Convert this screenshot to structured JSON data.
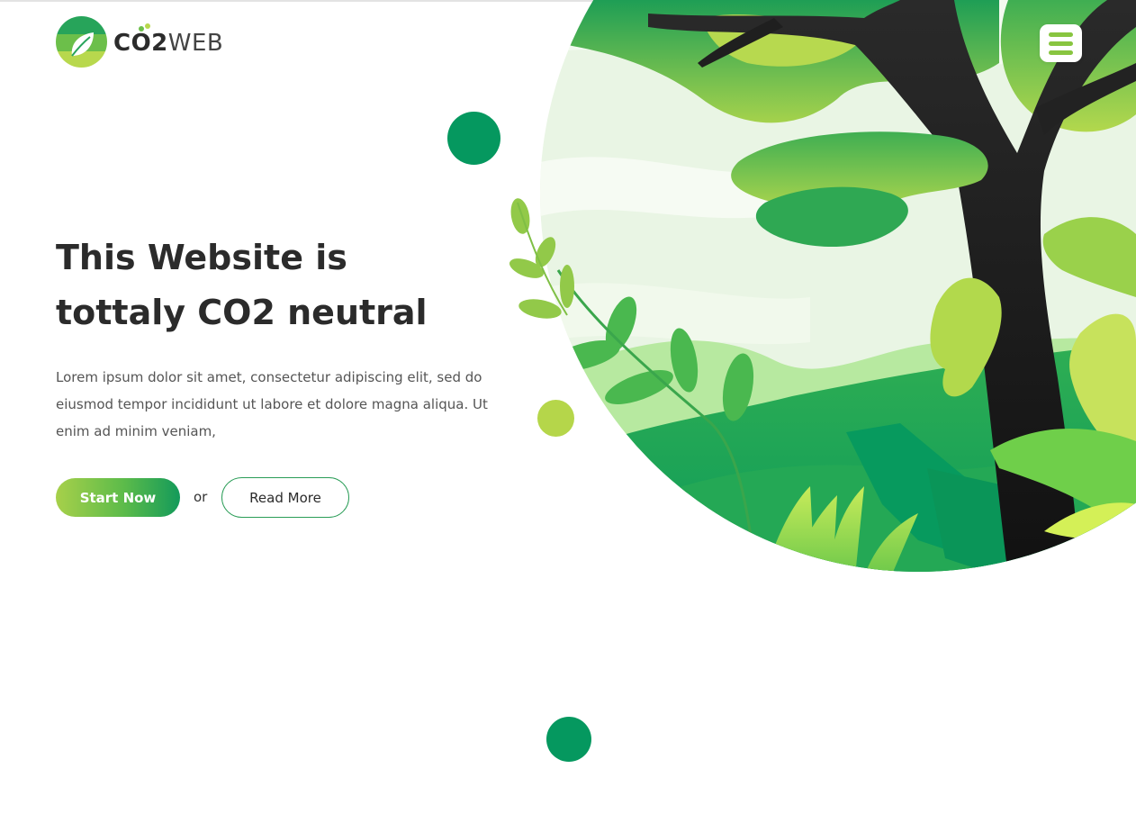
{
  "brand": {
    "logo_bold": "CO2",
    "logo_light": "WEB"
  },
  "hero": {
    "title": "This Website is tottaly CO2 neutral",
    "description": "Lorem ipsum dolor sit amet, consectetur adipiscing elit, sed do eiusmod tempor incididunt ut labore et dolore magna aliqua. Ut enim ad minim veniam,",
    "start_label": "Start Now",
    "or_label": "or",
    "read_label": "Read More"
  },
  "icons": {
    "menu": "hamburger-menu-icon",
    "logo": "leaf-icon",
    "illustration": "forest-tree-illustration"
  },
  "colors": {
    "primary_green": "#05985f",
    "light_green": "#b5d64a",
    "menu_green": "#88c540",
    "text_dark": "#2b2b2b"
  }
}
